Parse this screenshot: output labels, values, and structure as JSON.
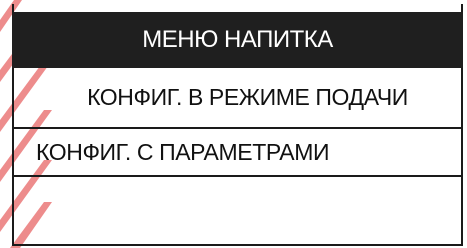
{
  "menu": {
    "title": "МЕНЮ НАПИТКА",
    "items": [
      {
        "label": "КОНФИГ. В РЕЖИМЕ ПОДАЧИ",
        "selected": false
      },
      {
        "label": "КОНФИГ. С ПАРАМЕТРАМИ",
        "selected": true
      }
    ]
  },
  "colors": {
    "title_background": "#1f1f1f",
    "title_text": "#ffffff",
    "item_text": "#111111",
    "frame": "#1a1a1a",
    "watermark": "#e03030"
  }
}
